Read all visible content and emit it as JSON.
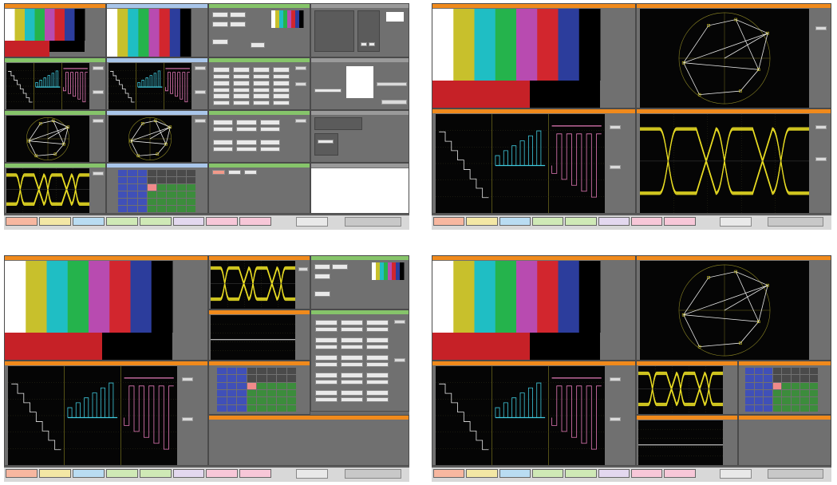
{
  "colors": {
    "bars": [
      "#ffffff",
      "#c8c02c",
      "#1fbec4",
      "#25b34c",
      "#b84bb0",
      "#d2262e",
      "#2c3d9c",
      "#000000"
    ],
    "bottom_red": "#c62127",
    "trace_yellow": "#e9dd24",
    "trace_cyan": "#3fc9dd",
    "trace_pink": "#e47ab8",
    "trace_white": "#e8e8e8",
    "title_orange": "#f08a1c",
    "title_green": "#86c46a",
    "title_blue": "#a9c6ea"
  },
  "screens": [
    "top-left",
    "top-right",
    "bottom-left",
    "bottom-right"
  ],
  "taskbar_tabs": [
    {
      "color": "#f7b7a0"
    },
    {
      "color": "#f3e7a5"
    },
    {
      "color": "#b9dcf2"
    },
    {
      "color": "#cfe9b6"
    },
    {
      "color": "#cfe9b6"
    },
    {
      "color": "#e3d8ef"
    },
    {
      "color": "#f7c7d8"
    },
    {
      "color": "#f7c7d8"
    }
  ],
  "icons": [
    "vectorscope-graticule",
    "eye-pattern",
    "waveform",
    "color-bars",
    "test-pattern"
  ]
}
